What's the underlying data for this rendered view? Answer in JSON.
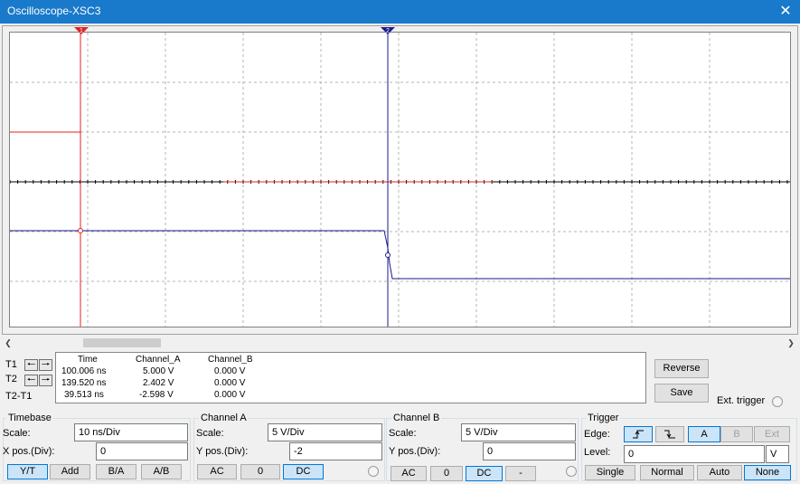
{
  "window": {
    "title": "Oscilloscope-XSC3",
    "close_glyph": "✕"
  },
  "cursors": {
    "t1_label": "T1",
    "t2_label": "T2",
    "t2_t1_label": "T2-T1",
    "t1_marker": "1",
    "t2_marker": "2"
  },
  "readout": {
    "headers": [
      "Time",
      "Channel_A",
      "Channel_B"
    ],
    "rows": [
      [
        "100.006 ns",
        "5.000 V",
        "0.000 V"
      ],
      [
        "139.520 ns",
        "2.402 V",
        "0.000 V"
      ],
      [
        "39.513 ns",
        "-2.598 V",
        "0.000 V"
      ]
    ]
  },
  "actions": {
    "reverse": "Reverse",
    "save": "Save",
    "ext_trigger": "Ext. trigger"
  },
  "timebase": {
    "title": "Timebase",
    "scale_label": "Scale:",
    "scale_value": "10 ns/Div",
    "xpos_label": "X pos.(Div):",
    "xpos_value": "0",
    "modes": [
      "Y/T",
      "Add",
      "B/A",
      "A/B"
    ],
    "selected_mode": "Y/T"
  },
  "channel_a": {
    "title": "Channel A",
    "scale_label": "Scale:",
    "scale_value": "5  V/Div",
    "ypos_label": "Y pos.(Div):",
    "ypos_value": "-2",
    "coupling": [
      "AC",
      "0",
      "DC"
    ],
    "selected_coupling": "DC"
  },
  "channel_b": {
    "title": "Channel B",
    "scale_label": "Scale:",
    "scale_value": "5  V/Div",
    "ypos_label": "Y pos.(Div):",
    "ypos_value": "0",
    "coupling": [
      "AC",
      "0",
      "DC",
      "-"
    ],
    "selected_coupling": "DC"
  },
  "trigger": {
    "title": "Trigger",
    "edge_label": "Edge:",
    "level_label": "Level:",
    "level_value": "0",
    "level_unit": "V",
    "sources": [
      "A",
      "B",
      "Ext"
    ],
    "selected_source": "A",
    "modes": [
      "Single",
      "Normal",
      "Auto",
      "None"
    ],
    "selected_mode": "None"
  },
  "colors": {
    "channel_a": "#e02020",
    "channel_b": "#1a1a8c",
    "titlebar": "#1979ca",
    "grid": "#b4b4b4"
  }
}
